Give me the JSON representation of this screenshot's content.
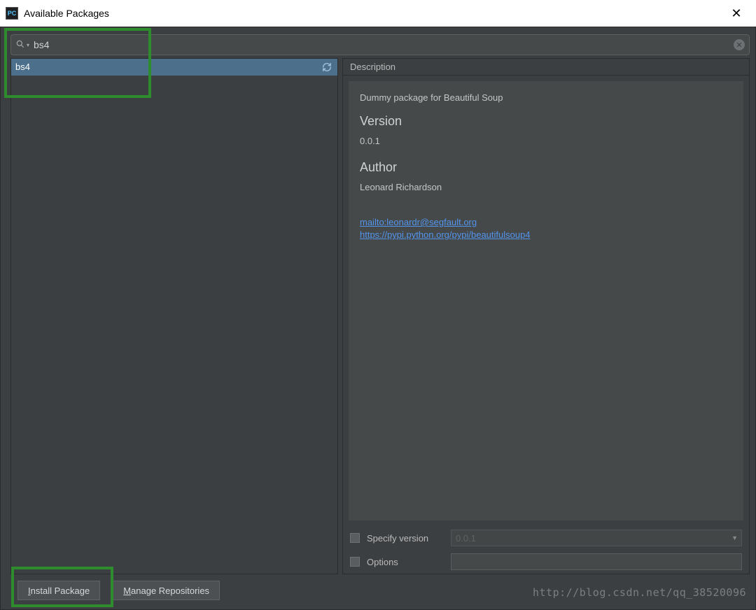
{
  "window": {
    "title": "Available Packages",
    "app_icon_label": "PC"
  },
  "search": {
    "value": "bs4"
  },
  "package_list": {
    "items": [
      "bs4"
    ],
    "selected_index": 0
  },
  "description": {
    "header": "Description",
    "summary": "Dummy package for Beautiful Soup",
    "version_label": "Version",
    "version_value": "0.0.1",
    "author_label": "Author",
    "author_value": "Leonard Richardson",
    "links": [
      "mailto:leonardr@segfault.org",
      "https://pypi.python.org/pypi/beautifulsoup4"
    ]
  },
  "specify_version": {
    "label": "Specify version",
    "checked": false,
    "value": "0.0.1"
  },
  "options": {
    "label": "Options",
    "checked": false,
    "value": ""
  },
  "buttons": {
    "install": "Install Package",
    "manage": "Manage Repositories"
  },
  "watermark": "http://blog.csdn.net/qq_38520096"
}
